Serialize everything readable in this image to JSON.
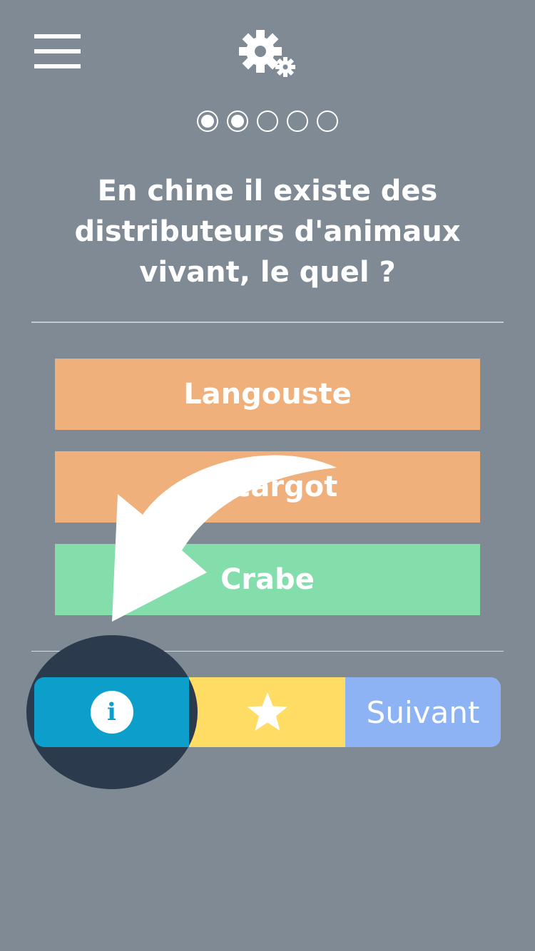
{
  "header": {
    "menu_icon": "hamburger-menu-icon",
    "settings_icon": "gears-icon"
  },
  "progress": {
    "total_steps": 5,
    "completed_steps": 2
  },
  "question": {
    "text": "En chine il existe des distributeurs d'animaux vivant, le quel ?"
  },
  "answers": [
    {
      "label": "Langouste",
      "color": "#f0b07c"
    },
    {
      "label": "Escargot",
      "color": "#f0b07c"
    },
    {
      "label": "Crabe",
      "color": "#84deab"
    }
  ],
  "toolbar": {
    "info_icon": "info-icon",
    "favorite_icon": "star-icon",
    "next_label": "Suivant"
  },
  "colors": {
    "background": "#7f8a94",
    "info": "#0d9fcc",
    "favorite": "#ffdc64",
    "next": "#8db3f5",
    "highlight": "#2b3a4c"
  }
}
